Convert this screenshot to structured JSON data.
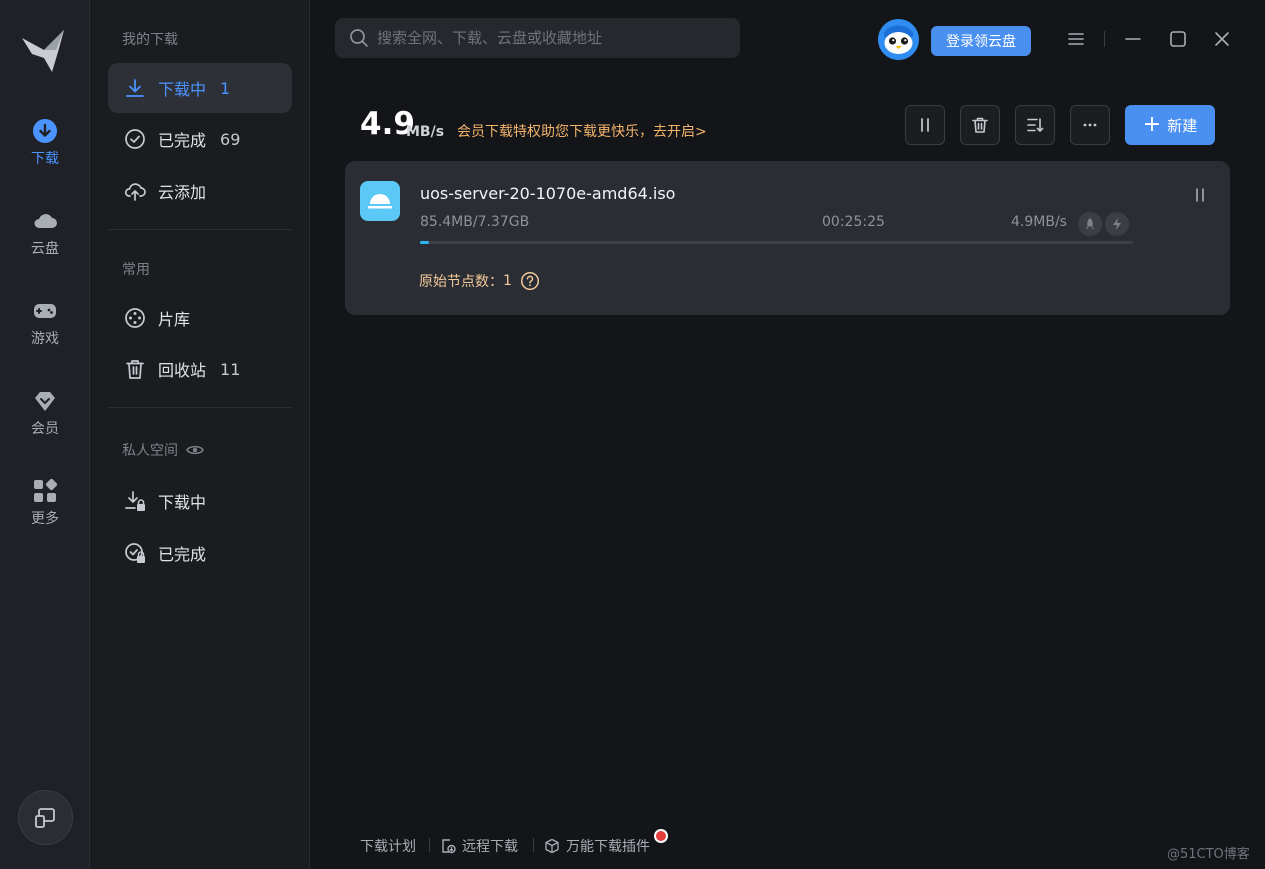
{
  "rail": {
    "items": [
      {
        "label": "下载",
        "icon": "download-icon",
        "active": true
      },
      {
        "label": "云盘",
        "icon": "cloud-icon"
      },
      {
        "label": "游戏",
        "icon": "gamepad-icon"
      },
      {
        "label": "会员",
        "icon": "diamond-icon"
      },
      {
        "label": "更多",
        "icon": "apps-icon"
      }
    ],
    "bottom_icon": "device-icon"
  },
  "sidebar": {
    "section_downloads": "我的下载",
    "downloading": {
      "label": "下载中",
      "count": "1"
    },
    "completed": {
      "label": "已完成",
      "count": "69"
    },
    "cloud_add": {
      "label": "云添加"
    },
    "section_common": "常用",
    "library": {
      "label": "片库"
    },
    "recycle": {
      "label": "回收站",
      "count": "11"
    },
    "section_private": "私人空间",
    "private_downloading": {
      "label": "下载中"
    },
    "private_completed": {
      "label": "已完成"
    }
  },
  "topbar": {
    "search_placeholder": "搜索全网、下载、云盘或收藏地址",
    "login_label": "登录领云盘"
  },
  "speedbar": {
    "speed_value": "4.9",
    "speed_unit": "MB/s",
    "promo_text": "会员下载特权助您下载更快乐，去开启>",
    "new_label": "新建"
  },
  "task": {
    "file_name": "uos-server-20-1070e-amd64.iso",
    "size_progress": "85.4MB/7.37GB",
    "remaining_time": "00:25:25",
    "speed": "4.9MB/s",
    "progress_percent": 1.2,
    "nodes_label": "原始节点数：",
    "nodes_count": "1"
  },
  "bottom": {
    "plan_label": "下载计划",
    "remote_label": "远程下载",
    "plugin_label": "万能下载插件"
  },
  "watermark": "@51CTO博客",
  "colors": {
    "accent": "#4a90f0",
    "active_text": "#4b93ff",
    "promo": "#f2b36b",
    "progress": "#2fb4f2",
    "background": "#141519"
  }
}
